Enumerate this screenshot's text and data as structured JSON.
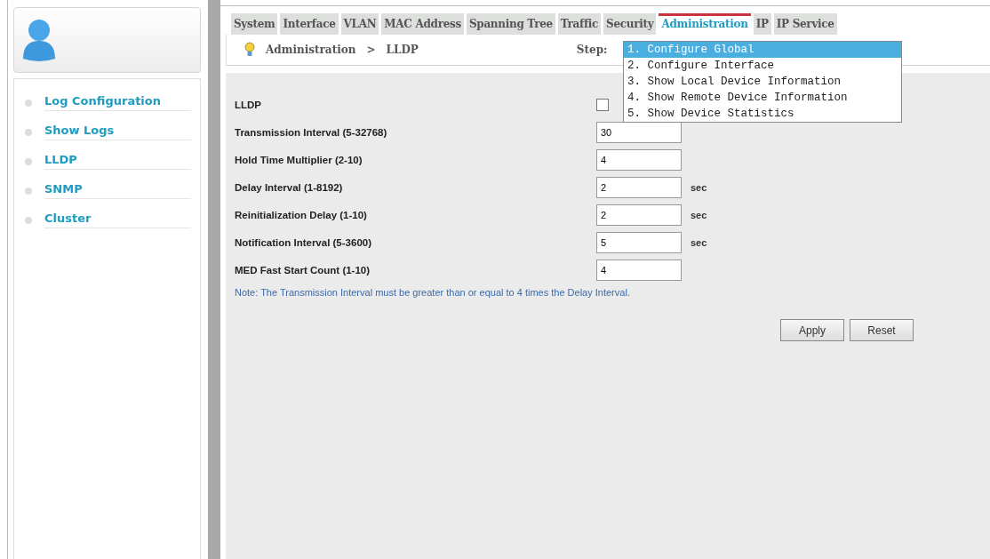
{
  "sidebar": {
    "items": [
      {
        "label": "Log Configuration"
      },
      {
        "label": "Show Logs"
      },
      {
        "label": "LLDP"
      },
      {
        "label": "SNMP"
      },
      {
        "label": "Cluster"
      }
    ]
  },
  "tabs": [
    {
      "label": "System",
      "selected": false
    },
    {
      "label": "Interface",
      "selected": false
    },
    {
      "label": "VLAN",
      "selected": false
    },
    {
      "label": "MAC Address",
      "selected": false
    },
    {
      "label": "Spanning Tree",
      "selected": false
    },
    {
      "label": "Traffic",
      "selected": false
    },
    {
      "label": "Security",
      "selected": false
    },
    {
      "label": "Administration",
      "selected": true
    },
    {
      "label": "IP",
      "selected": false
    },
    {
      "label": "IP Service",
      "selected": false
    }
  ],
  "breadcrumb": {
    "section": "Administration",
    "separator": ">",
    "page": "LLDP"
  },
  "step": {
    "label": "Step:",
    "options": [
      {
        "label": "1. Configure Global",
        "selected": true
      },
      {
        "label": "2. Configure Interface",
        "selected": false
      },
      {
        "label": "3. Show Local Device Information",
        "selected": false
      },
      {
        "label": "4. Show Remote Device Information",
        "selected": false
      },
      {
        "label": "5. Show Device Statistics",
        "selected": false
      }
    ]
  },
  "form": {
    "fields": [
      {
        "kind": "checkbox",
        "label": "LLDP",
        "checked": false
      },
      {
        "kind": "input",
        "label": "Transmission Interval (5-32768)",
        "value": "30"
      },
      {
        "kind": "input",
        "label": "Hold Time Multiplier (2-10)",
        "value": "4"
      },
      {
        "kind": "input",
        "label": "Delay Interval (1-8192)",
        "value": "2",
        "unit": "sec"
      },
      {
        "kind": "input",
        "label": "Reinitialization Delay (1-10)",
        "value": "2",
        "unit": "sec"
      },
      {
        "kind": "input",
        "label": "Notification Interval (5-3600)",
        "value": "5",
        "unit": "sec"
      },
      {
        "kind": "input",
        "label": "MED Fast Start Count (1-10)",
        "value": "4"
      }
    ],
    "note": "Note: The Transmission Interval must be greater than or equal to 4 times the Delay Interval.",
    "buttons": [
      "Apply",
      "Reset"
    ]
  }
}
